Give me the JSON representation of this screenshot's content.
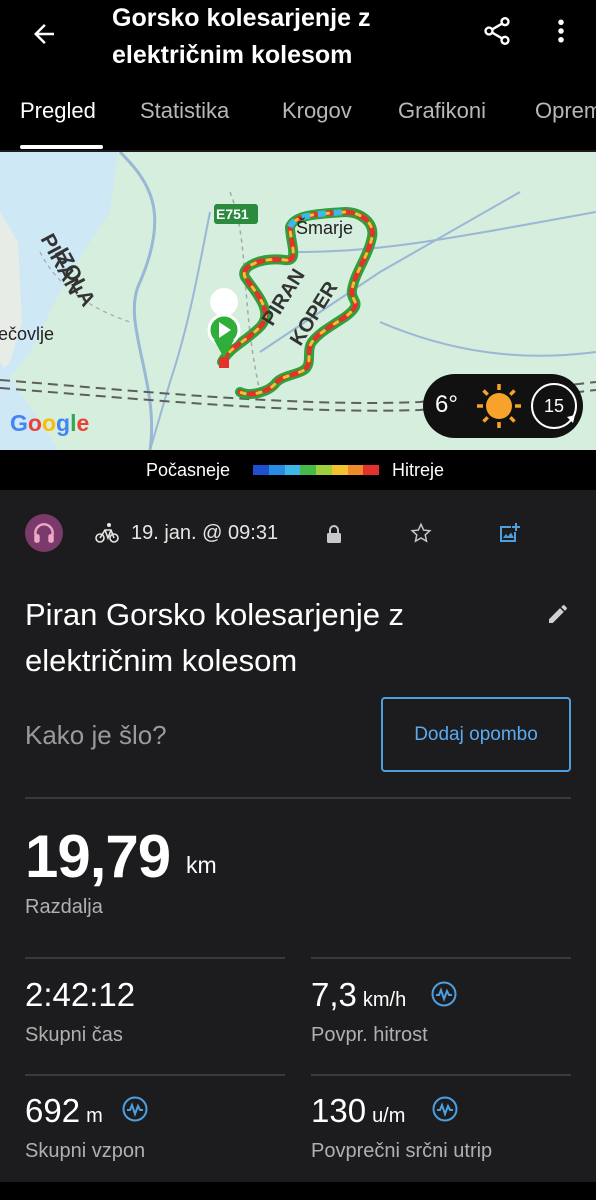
{
  "header": {
    "title": "Gorsko kolesarjenje z električnim kolesom",
    "back_icon": "arrow-left-icon",
    "share_icon": "share-icon",
    "menu_icon": "more-vert-icon"
  },
  "tabs": [
    {
      "label": "Pregled",
      "active": true
    },
    {
      "label": "Statistika",
      "active": false
    },
    {
      "label": "Krogov",
      "active": false
    },
    {
      "label": "Grafikoni",
      "active": false
    },
    {
      "label": "Opreme",
      "active": false
    }
  ],
  "map": {
    "labels": {
      "izola": "IZOLA",
      "piran_left": "PIRAN",
      "road": "E751",
      "smarje": "Šmarje",
      "piran_route": "PIRAN",
      "koper": "KOPER",
      "city": "ečovlje",
      "google": "Google"
    },
    "weather": {
      "temperature": "6°",
      "wind": "15",
      "sun_icon": "sun-icon"
    }
  },
  "legend": {
    "slow": "Počasneje",
    "fast": "Hitreje",
    "colors": [
      "#1f4fd1",
      "#2a8be3",
      "#3fb7e9",
      "#46b94a",
      "#9dd03b",
      "#f2c32e",
      "#f08a2a",
      "#e3322b"
    ]
  },
  "activity": {
    "date": "19. jan. @ 09:31",
    "title": "Piran Gorsko kolesarjenje z električnim kolesom",
    "prompt": "Kako je šlo?",
    "note_button": "Dodaj opombo"
  },
  "stats": {
    "distance": {
      "value": "19,79",
      "unit": "km",
      "label": "Razdalja"
    },
    "total_time": {
      "value": "2:42:12",
      "label": "Skupni čas"
    },
    "avg_speed": {
      "value": "7,3",
      "unit": "km/h",
      "label": "Povpr. hitrost"
    },
    "ascent": {
      "value": "692",
      "unit": "m",
      "label": "Skupni vzpon"
    },
    "heart_rate": {
      "value": "130",
      "unit": "u/m",
      "label": "Povprečni srčni utrip"
    }
  },
  "colors": {
    "accent": "#4d9fe0",
    "background": "#1c1c1e",
    "header": "#000000",
    "map_land": "#d5eedd"
  }
}
